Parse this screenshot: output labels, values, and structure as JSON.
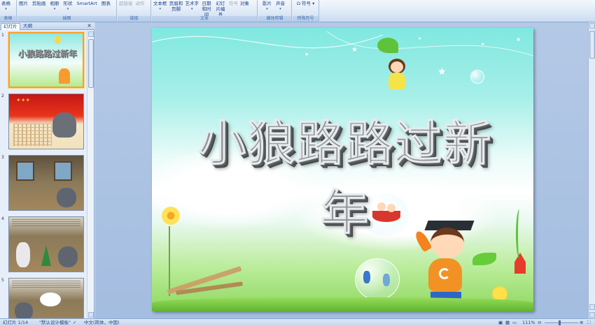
{
  "ribbon": {
    "groups": [
      {
        "name": "表格",
        "buttons": [
          "表格"
        ]
      },
      {
        "name": "插图",
        "buttons": [
          "图片",
          "剪贴画",
          "相册",
          "形状",
          "SmartArt",
          "图表"
        ]
      },
      {
        "name": "链接",
        "buttons": [
          "超链接",
          "动作"
        ]
      },
      {
        "name": "文本",
        "buttons": [
          "文本框",
          "页眉和页脚",
          "艺术字",
          "日期和时间",
          "幻灯片编号",
          "符号",
          "对象"
        ]
      },
      {
        "name": "媒体剪辑",
        "buttons": [
          "影片",
          "声音"
        ]
      },
      {
        "name": "特殊符号",
        "buttons": [
          "符号"
        ]
      }
    ]
  },
  "panel": {
    "tab_slides": "幻灯片",
    "tab_outline": "大纲",
    "close": "×",
    "slide_numbers": [
      "1",
      "2",
      "3",
      "4",
      "5"
    ]
  },
  "slide": {
    "title": "小狼路路过新年"
  },
  "status": {
    "slide_pos": "幻灯片 1/14",
    "theme": "\"默认设计模板\"",
    "language": "中文(简体，中国)",
    "zoom": "111%"
  },
  "colors": {
    "ribbon_bg": "#dde8f6",
    "selected_thumb": "#f5a033",
    "workspace_bg": "#abc3e3"
  }
}
